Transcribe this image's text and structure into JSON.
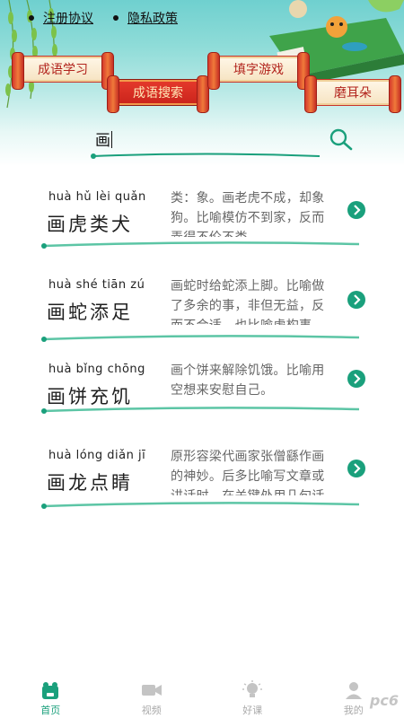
{
  "header": {
    "links": [
      {
        "label": "注册协议"
      },
      {
        "label": "隐私政策"
      }
    ],
    "tabs": [
      {
        "label": "成语学习",
        "active": false
      },
      {
        "label": "成语搜索",
        "active": true
      },
      {
        "label": "填字游戏",
        "active": false
      },
      {
        "label": "磨耳朵",
        "active": false
      }
    ]
  },
  "search": {
    "value": "画"
  },
  "results": [
    {
      "pinyin": "huà hǔ lèi quǎn",
      "word": "画虎类犬",
      "meaning": "类：象。画老虎不成，却象狗。比喻模仿不到家，反而弄得不伦不类。"
    },
    {
      "pinyin": "huà shé tiān zú",
      "word": "画蛇添足",
      "meaning": "画蛇时给蛇添上脚。比喻做了多余的事，非但无益，反而不合适。也比喻虚构事实，无中生有。"
    },
    {
      "pinyin": "huà bǐng chōng",
      "word": "画饼充饥",
      "meaning": "画个饼来解除饥饿。比喻用空想来安慰自己。"
    },
    {
      "pinyin": "huà lóng diǎn jī",
      "word": "画龙点睛",
      "meaning": "原形容梁代画家张僧繇作画的神妙。后多比喻写文章或讲话时，在关键处用几句话点明实质，使内容更加生动有力。"
    }
  ],
  "bottom_nav": [
    {
      "label": "首页",
      "icon": "home-icon",
      "active": true
    },
    {
      "label": "视频",
      "icon": "video-icon",
      "active": false
    },
    {
      "label": "好课",
      "icon": "lightbulb-icon",
      "active": false
    },
    {
      "label": "我的",
      "icon": "profile-icon",
      "active": false
    }
  ],
  "watermark": "pc6",
  "colors": {
    "accent": "#1aa07c",
    "header_teal": "#6fd0cf",
    "scroll_red": "#c9231b"
  }
}
